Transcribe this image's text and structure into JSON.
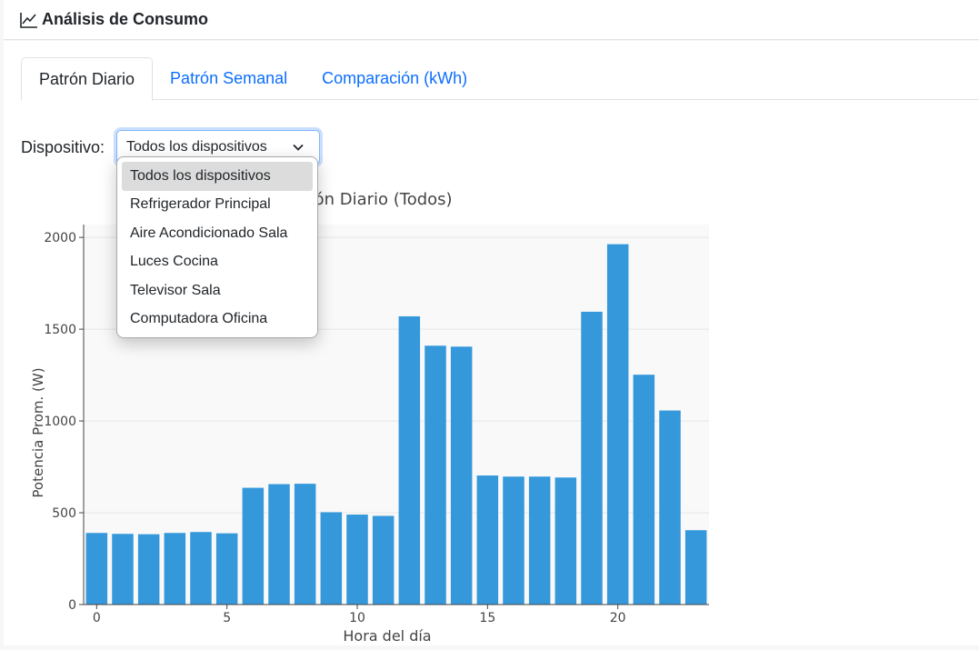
{
  "header": {
    "title": "Análisis de Consumo",
    "icon": "line-chart-icon"
  },
  "tabs": [
    {
      "label": "Patrón Diario",
      "active": true
    },
    {
      "label": "Patrón Semanal",
      "active": false
    },
    {
      "label": "Comparación (kWh)",
      "active": false
    }
  ],
  "device_filter": {
    "label": "Dispositivo:",
    "selected": "Todos los dispositivos",
    "options": [
      "Todos los dispositivos",
      "Refrigerador Principal",
      "Aire Acondicionado Sala",
      "Luces Cocina",
      "Televisor Sala",
      "Computadora Oficina"
    ]
  },
  "colors": {
    "bar": "#3498db",
    "accent": "#0d6efd"
  },
  "chart_data": {
    "type": "bar",
    "title": "Patrón Diario (Todos)",
    "xlabel": "Hora del día",
    "ylabel": "Potencia Prom. (W)",
    "x": [
      0,
      1,
      2,
      3,
      4,
      5,
      6,
      7,
      8,
      9,
      10,
      11,
      12,
      13,
      14,
      15,
      16,
      17,
      18,
      19,
      20,
      21,
      22,
      23
    ],
    "values": [
      390,
      385,
      383,
      390,
      395,
      388,
      636,
      656,
      658,
      503,
      490,
      483,
      1570,
      1410,
      1405,
      703,
      697,
      697,
      692,
      1595,
      1963,
      1252,
      1057,
      405
    ],
    "xlim": [
      -0.5,
      23.5
    ],
    "ylim": [
      0,
      2070
    ],
    "xticks": [
      0,
      5,
      10,
      15,
      20
    ],
    "yticks": [
      0,
      500,
      1000,
      1500,
      2000
    ],
    "grid": true
  }
}
